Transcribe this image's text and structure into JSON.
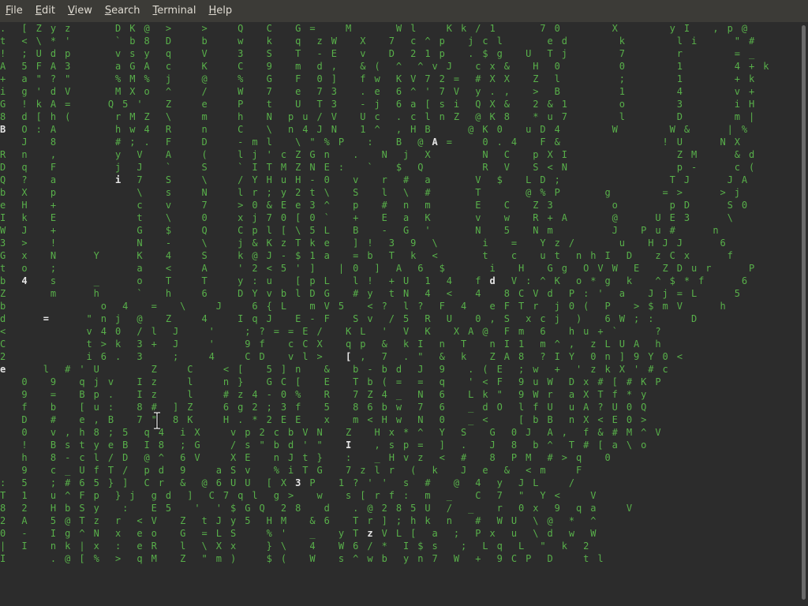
{
  "menubar": {
    "items": [
      {
        "label": "File",
        "mnemonic": "F",
        "rest": "ile"
      },
      {
        "label": "Edit",
        "mnemonic": "E",
        "rest": "dit"
      },
      {
        "label": "View",
        "mnemonic": "V",
        "rest": "iew"
      },
      {
        "label": "Search",
        "mnemonic": "S",
        "rest": "earch"
      },
      {
        "label": "Terminal",
        "mnemonic": "T",
        "rest": "erminal"
      },
      {
        "label": "Help",
        "mnemonic": "H",
        "rest": "elp"
      }
    ]
  },
  "terminal": {
    "glyph_color": "#58b04a",
    "highlight_color": "#e6e6e6",
    "background": "#2c2c2c",
    "rows": [
      ".  [ Z y z      D K @  >    >    Q   C   G =    M      W l    K k / 1      7 0       X       y I   , p @",
      "t  < \\ * '      ` b 8  D    b    w   k   q  z W   X   7  c ^ p   j c l      e d       k       l i     \" #",
      "!  ; U d p      v s y  q    V    3   S   T  - E   v   D  2 1 p   . $ g   U  T j       7       r       = _",
      "A  5 F A 3      a G A  c    K    C   9   m  d ,   & (  ^  ^ v J   c x &   H  0        0       1       4 + k",
      "+  a \" ? \"      % M %  j    @    %   G   F  0 ]   f w  K V 7 2 =  # X X   Z  l        ;       1       + k",
      "i  g ' d V      M X o  ^    /    W   7   e  7 3   . e  6 ^ ' 7 V  y . ,   >  B        1       4       v +",
      "G  ! k A =     Q 5 '   Z    e    P   t   U  T 3   - j  6 a [ s i  Q X &   2 & 1       o       3       i H",
      "8  d [ h (      r M Z  \\    m    h   N  p u / V   U c  . c l n Z  @ K 8   * u 7       l       D       m |",
      "B  O : A        h w 4  R    n    C   \\  n 4 J N   1 ^  , H B     @ K 0   u D 4       W       W &     | %",
      "   J   8        # ; .  F    D    - m l   \\ \" % P   :   B  @ A =    0 . 4   F &              ! U     N X",
      "R  n   ,        y  V   A    (    l j ' c Z G n   .   N  j  X       N  C   p X I               Z M     & d",
      "D  q   F        j  J   `    S    ` I T M Z N E :   `   $  Q        R  V   S < N               p -     c (",
      "Q  ?   a        i  7   S    \\    / Y H u H - 0   v   r  #  a      V  $   L D ;               T J     J A",
      "b  X   p           \\   s    N    l r ; y 2 t \\   S   l  \\  #      T      @ % P      g       = >     > j",
      "e  H   +           c   v    7    > 0 & E e 3 ^   p   #  n  m      E   C   Z 3        o       p D     S 0",
      "I  k   E           t   \\    0    x j 7 0 [ 0 `   +   E  a  K      v   w   R + A      @     U E 3     \\",
      "W  J   +           G   $    Q    C p l [ \\ 5 L   B   -  G  '      N   5   N m        J   P u #     n",
      "3  >   !           N   -    \\    j & K z T k e   ] !  3  9  \\      i   =   Y z /      u   H J J     6",
      "G  x   N     Y     K   4    S    k @ J - $ 1 a   = b  T  k  <      t   c   u t  n h I  D   z C x     f",
      "t  o   ;           a   <    A    ' 2 < 5 ' ]   | 0  ]  A  6  $      i   H   G g  O V W  E   Z D u r     P",
      "b  4   s     _     o   T    T    y : u   [ p L   l !  + U  1  4   f d  V : ^ K  o * g  k   ^ $ * f     6",
      "Z      m     h     `   h    6    D Y v b l D G   # y  t N  4  <   4   8 C V d  P : '  a   J j = L     5",
      "b             o  4   =   \\    J    6 { L   m V 5   < ?  l ?  F  4   e F T r  j 0 (  P   > $ m V     h",
      "d     =     \" n j  @   Z    4    I q J   E - F   S v  / 5  R  U   0 , S  x c j  )   6 W ; :     D",
      "<           v 4 0  / l  J    '    ; ? = = E /   K L  '  V  K   X A @  F m  6   h u + `     ?",
      "C           t > k  3 +  J    '    9 f   c C X   q p  &  k I  n  T   n I 1  m ^ ,  z L U A  h",
      "2           i 6 .  3    ;    4    C D   v l >   [ ,  7  . \"  &  k   Z A 8  ? I Y  0 n ] 9 Y 0 <",
      "e     l  # ' U       Z    C    < [   5 ] n   &   b - b d  J  9   . ( E  ; w  +  ' z k X ' # c",
      "   0   9   q j v   I z    l    n }   G C [   E   T b ( =  =  q   ' < F  9 u W  D x # [ # K P",
      "   9   =   B p .   I z    l    # z 4 - 0 %   R   7 Z 4 _  N  6   L k \"  9 W r  a X T f * y",
      "   f   b   [ u :   8 #  ] Z    6 g 2 ; 3 f   5   8 6 b w  7  6   _ d O  l f U  u A ? U 0 Q",
      "   D   #   e , B   7 \"  8 K    H . * 2 E E   x   m < H w  N  0   _ <    [ b B  n X < E 0 >",
      "   0   v , h 8 ; 5  q 4  i X    v p 2 c b V N   Z   H x * ^  Y  S   G  0 J  A ,  f & # M ^ V",
      "   !   B s t y e B  I 8  ; G    / s \" b d ' \"   I   , s p =  ]  .   J  8  b ^  T # [ a \\ o",
      "   h   8 - c l / D  @ ^  6 V    X E   n J t }   :   _ H v z  <  #   8  P M  # > q   0",
      "   9   c _ U f T /  p d  9    a S v   % i T G   7 z l r  (  k   J  e  &  < m    F",
      ":  5   ; # 6 5 } ]  C r  &  @ 6 U U  [ X 3 P   1 ? ' '  s  #   @  4  y  J L    /",
      "T  1   u ^ F p  } j  g d  ]  C 7 q l  g >   w   s [ r f :  m  _   C  7  \"  Y <    V",
      "8  2   H b S y   :   E 5   '  ' $ G Q  2 8   d   . @ 2 8 5 U  /  _   r  0 x  9  q a    V",
      "2  A   5 @ T z  r  < V   Z  t J y 5  H M   & 6   T r ] ; h k  n   #  W U  \\ @  *  ^",
      "0  -   I g ^ N  x  e o   G  = L S    % '   _   y T z V L [  a  ;  P x  u  \\ d  w  W",
      "|  I   n k | x  :  e R   l  \\ X x    } \\   4   W 6 / *  I $ s   ;  L q  L  \"  k  2",
      "I      . @ [ %  >  q M   Z  \" m )    $ (   W   s ^ w b  y n 7  W  +  9 C P  D    t l"
    ],
    "highlights": [
      {
        "row": 0,
        "col": 74,
        "ch": "k"
      },
      {
        "row": 1,
        "col": 103,
        "ch": "i"
      },
      {
        "row": 2,
        "col": 79,
        "ch": "T"
      },
      {
        "row": 5,
        "col": 21,
        "ch": "o"
      },
      {
        "row": 7,
        "col": 70,
        "ch": "n"
      },
      {
        "row": 7,
        "col": 72,
        "ch": "Z"
      },
      {
        "row": 7,
        "col": 92,
        "ch": "W"
      },
      {
        "row": 8,
        "col": 0,
        "ch": "B"
      },
      {
        "row": 8,
        "col": 17,
        "ch": "w"
      },
      {
        "row": 8,
        "col": 52,
        "ch": "1"
      },
      {
        "row": 9,
        "col": 48,
        "ch": "P"
      },
      {
        "row": 9,
        "col": 60,
        "ch": "A"
      },
      {
        "row": 9,
        "col": 74,
        "ch": "."
      },
      {
        "row": 10,
        "col": 55,
        "ch": "N"
      },
      {
        "row": 12,
        "col": 16,
        "ch": "i"
      },
      {
        "row": 14,
        "col": 107,
        "ch": "S"
      },
      {
        "row": 15,
        "col": 30,
        "ch": "0"
      },
      {
        "row": 15,
        "col": 101,
        "ch": "3"
      },
      {
        "row": 17,
        "col": 42,
        "ch": "T"
      },
      {
        "row": 19,
        "col": 40,
        "ch": "5"
      },
      {
        "row": 19,
        "col": 56,
        "ch": "]"
      },
      {
        "row": 20,
        "col": 3,
        "ch": "4"
      },
      {
        "row": 20,
        "col": 68,
        "ch": "d"
      },
      {
        "row": 22,
        "col": 73,
        "ch": "e"
      },
      {
        "row": 23,
        "col": 6,
        "ch": "="
      },
      {
        "row": 23,
        "col": 34,
        "ch": "I"
      },
      {
        "row": 23,
        "col": 81,
        "ch": "x"
      },
      {
        "row": 24,
        "col": 108,
        "ch": "?"
      },
      {
        "row": 25,
        "col": 20,
        "ch": "3"
      },
      {
        "row": 26,
        "col": 25,
        "ch": ";"
      },
      {
        "row": 26,
        "col": 48,
        "ch": "["
      },
      {
        "row": 27,
        "col": 0,
        "ch": "e"
      },
      {
        "row": 27,
        "col": 90,
        "ch": "+"
      },
      {
        "row": 28,
        "col": 103,
        "ch": "K"
      },
      {
        "row": 30,
        "col": 78,
        "ch": "d"
      },
      {
        "row": 31,
        "col": 88,
        "ch": "B"
      },
      {
        "row": 32,
        "col": 66,
        "ch": "S"
      },
      {
        "row": 32,
        "col": 79,
        "ch": "O"
      },
      {
        "row": 33,
        "col": 48,
        "ch": "I"
      },
      {
        "row": 33,
        "col": 94,
        "ch": "T"
      },
      {
        "row": 33,
        "col": 98,
        "ch": "a"
      },
      {
        "row": 34,
        "col": 28,
        "ch": "V"
      },
      {
        "row": 34,
        "col": 88,
        "ch": "P"
      },
      {
        "row": 34,
        "col": 100,
        "ch": "q"
      },
      {
        "row": 35,
        "col": 16,
        "ch": "T"
      },
      {
        "row": 36,
        "col": 41,
        "ch": "3"
      },
      {
        "row": 37,
        "col": 60,
        "ch": "m"
      },
      {
        "row": 39,
        "col": 35,
        "ch": "5"
      },
      {
        "row": 39,
        "col": 42,
        "ch": "&"
      },
      {
        "row": 40,
        "col": 5,
        "ch": "-"
      },
      {
        "row": 40,
        "col": 51,
        "ch": "z"
      },
      {
        "row": 40,
        "col": 56,
        "ch": "["
      },
      {
        "row": 40,
        "col": 95,
        "ch": "d"
      },
      {
        "row": 41,
        "col": 101,
        "ch": "k"
      },
      {
        "row": 42,
        "col": 38,
        "ch": "("
      },
      {
        "row": 42,
        "col": 73,
        "ch": "+"
      }
    ]
  }
}
